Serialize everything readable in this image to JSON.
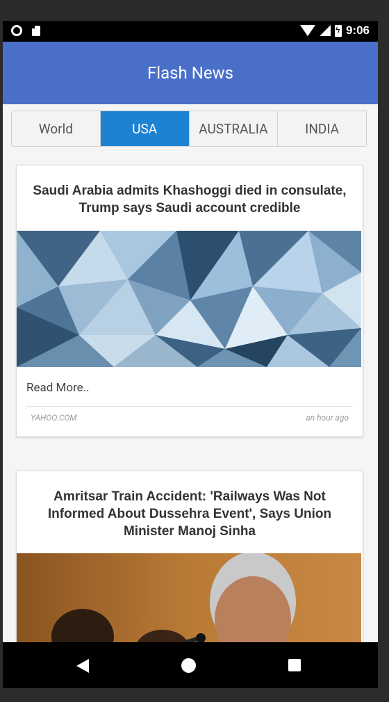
{
  "app": {
    "title": "Flash News"
  },
  "status_bar": {
    "time": "9:06"
  },
  "tabs": [
    {
      "label": "World",
      "active": false
    },
    {
      "label": "USA",
      "active": true
    },
    {
      "label": "AUSTRALIA",
      "active": false
    },
    {
      "label": "INDIA",
      "active": false
    }
  ],
  "articles": [
    {
      "title": "Saudi Arabia admits Khashoggi died in consulate, Trump says Saudi account credible",
      "read_more": "Read More..",
      "source": "YAHOO.COM",
      "time": "an hour ago"
    },
    {
      "title": "Amritsar Train Accident: 'Railways Was Not Informed About Dussehra Event', Says Union Minister Manoj Sinha"
    }
  ],
  "colors": {
    "appbar": "#4a6fc9",
    "active_tab": "#1e82d2"
  },
  "icons": [
    "back-icon",
    "home-icon",
    "recents-icon",
    "wifi-icon",
    "signal-icon",
    "battery-icon"
  ]
}
